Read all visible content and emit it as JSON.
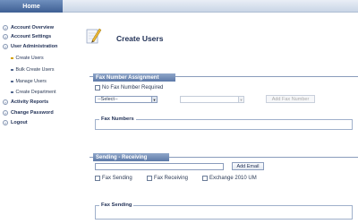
{
  "header": {
    "home_label": "Home"
  },
  "sidebar": {
    "items": [
      {
        "label": "Account Overview"
      },
      {
        "label": "Account Settings"
      },
      {
        "label": "User Administration"
      },
      {
        "label": "Activity Reports"
      },
      {
        "label": "Change Password"
      },
      {
        "label": "Logout"
      }
    ],
    "sub_items": [
      {
        "label": "Create Users",
        "active": true
      },
      {
        "label": "Bulk Create Users"
      },
      {
        "label": "Manage Users"
      },
      {
        "label": "Create Department"
      }
    ]
  },
  "page": {
    "title": "Create Users"
  },
  "fax_assignment": {
    "header": "Fax Number Assignment",
    "no_fax_label": "No Fax Number Required",
    "select_value": "--Select--",
    "second_select_value": "",
    "add_button": "Add Fax Number",
    "fax_numbers_legend": "Fax Numbers"
  },
  "sending": {
    "header": "Sending - Receiving",
    "email_value": "",
    "add_email_button": "Add Email",
    "options": [
      "Fax Sending",
      "Fax Receiving",
      "Exchange 2010 UM"
    ],
    "fax_sending_legend": "Fax Sending"
  },
  "colors": {
    "accent": "#5d7aa8",
    "header_blue": "#3e5f93",
    "active_dot": "#d4a200"
  }
}
